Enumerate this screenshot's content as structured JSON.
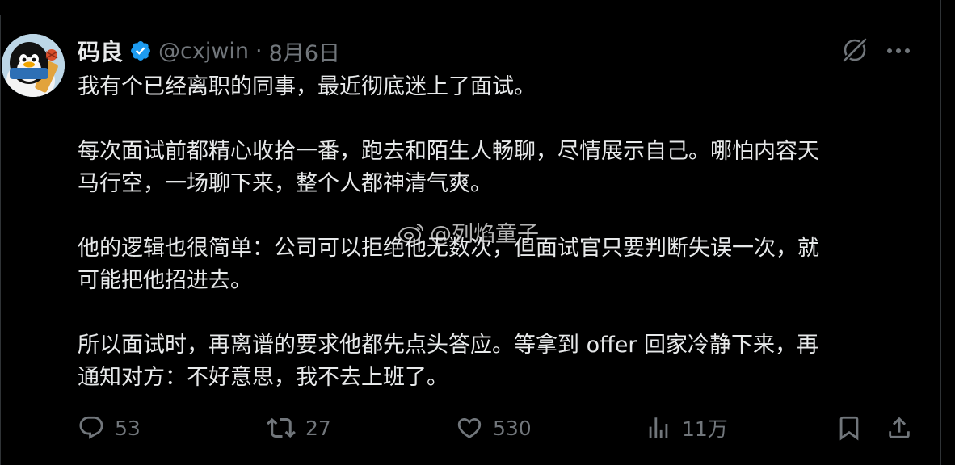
{
  "post": {
    "author_name": "码良",
    "handle": "@cxjwin",
    "separator": "·",
    "date": "8月6日",
    "paragraphs": [
      [
        "我有个已经离职的同事，最近彻底迷上了面试。"
      ],
      [
        "每次面试前都精心收拾一番，跑去和陌生人畅聊，尽情展示自己。哪怕内容天",
        "马行空，一场聊下来，整个人都神清气爽。"
      ],
      [
        "他的逻辑也很简单：公司可以拒绝他无数次，但面试官只要判断失误一次，就",
        "可能把他招进去。"
      ],
      [
        "所以面试时，再离谱的要求他都先点头答应。等拿到 offer 回家冷静下来，再",
        "通知对方：不好意思，我不去上班了。"
      ]
    ]
  },
  "watermark": {
    "text": "@列焰童子",
    "icon": "weibo-icon"
  },
  "actions": {
    "reply_count": "53",
    "repost_count": "27",
    "like_count": "530",
    "views_count": "11万"
  },
  "icons": {
    "verified": "verified-badge-icon",
    "grok": "grok-icon",
    "more": "more-icon",
    "reply": "reply-icon",
    "repost": "repost-icon",
    "like": "like-icon",
    "views": "views-icon",
    "bookmark": "bookmark-icon",
    "share": "share-icon"
  },
  "colors": {
    "background": "#000000",
    "text_primary": "#e7e9ea",
    "text_secondary": "#71767b",
    "verified_blue": "#1d9bf0",
    "border": "#2f3336"
  }
}
